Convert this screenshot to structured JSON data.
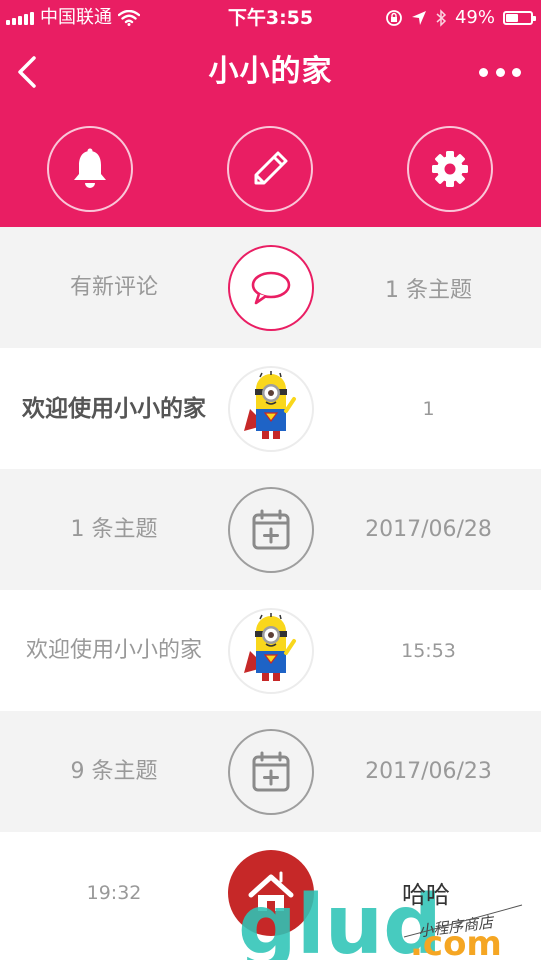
{
  "status_bar": {
    "carrier": "中国联通",
    "time": "下午3:55",
    "battery_percent": "49%",
    "battery_level": 0.49
  },
  "header": {
    "title": "小小的家",
    "background_color": "#e91e63",
    "icons": {
      "back": "chevron-left-icon",
      "more": "more-dots-icon",
      "notifications": "bell-icon",
      "edit": "pencil-icon",
      "settings": "gear-icon"
    }
  },
  "timeline": {
    "rows": [
      {
        "left": "有新评论",
        "right": "1 条主题",
        "node": "comment-icon"
      },
      {
        "left": "欢迎使用小小的家",
        "right": "1",
        "node": "avatar"
      },
      {
        "left": "1 条主题",
        "right": "2017/06/28",
        "node": "calendar-add-icon"
      },
      {
        "left": "欢迎使用小小的家",
        "right": "15:53",
        "node": "avatar"
      },
      {
        "left": "9 条主题",
        "right": "2017/06/23",
        "node": "calendar-add-icon"
      },
      {
        "left": "19:32",
        "right": "",
        "node": "app-logo"
      }
    ]
  },
  "watermark": {
    "brand": "glud",
    "domain": ".com",
    "title": "哈哈",
    "subtitle": "小程序商店"
  }
}
